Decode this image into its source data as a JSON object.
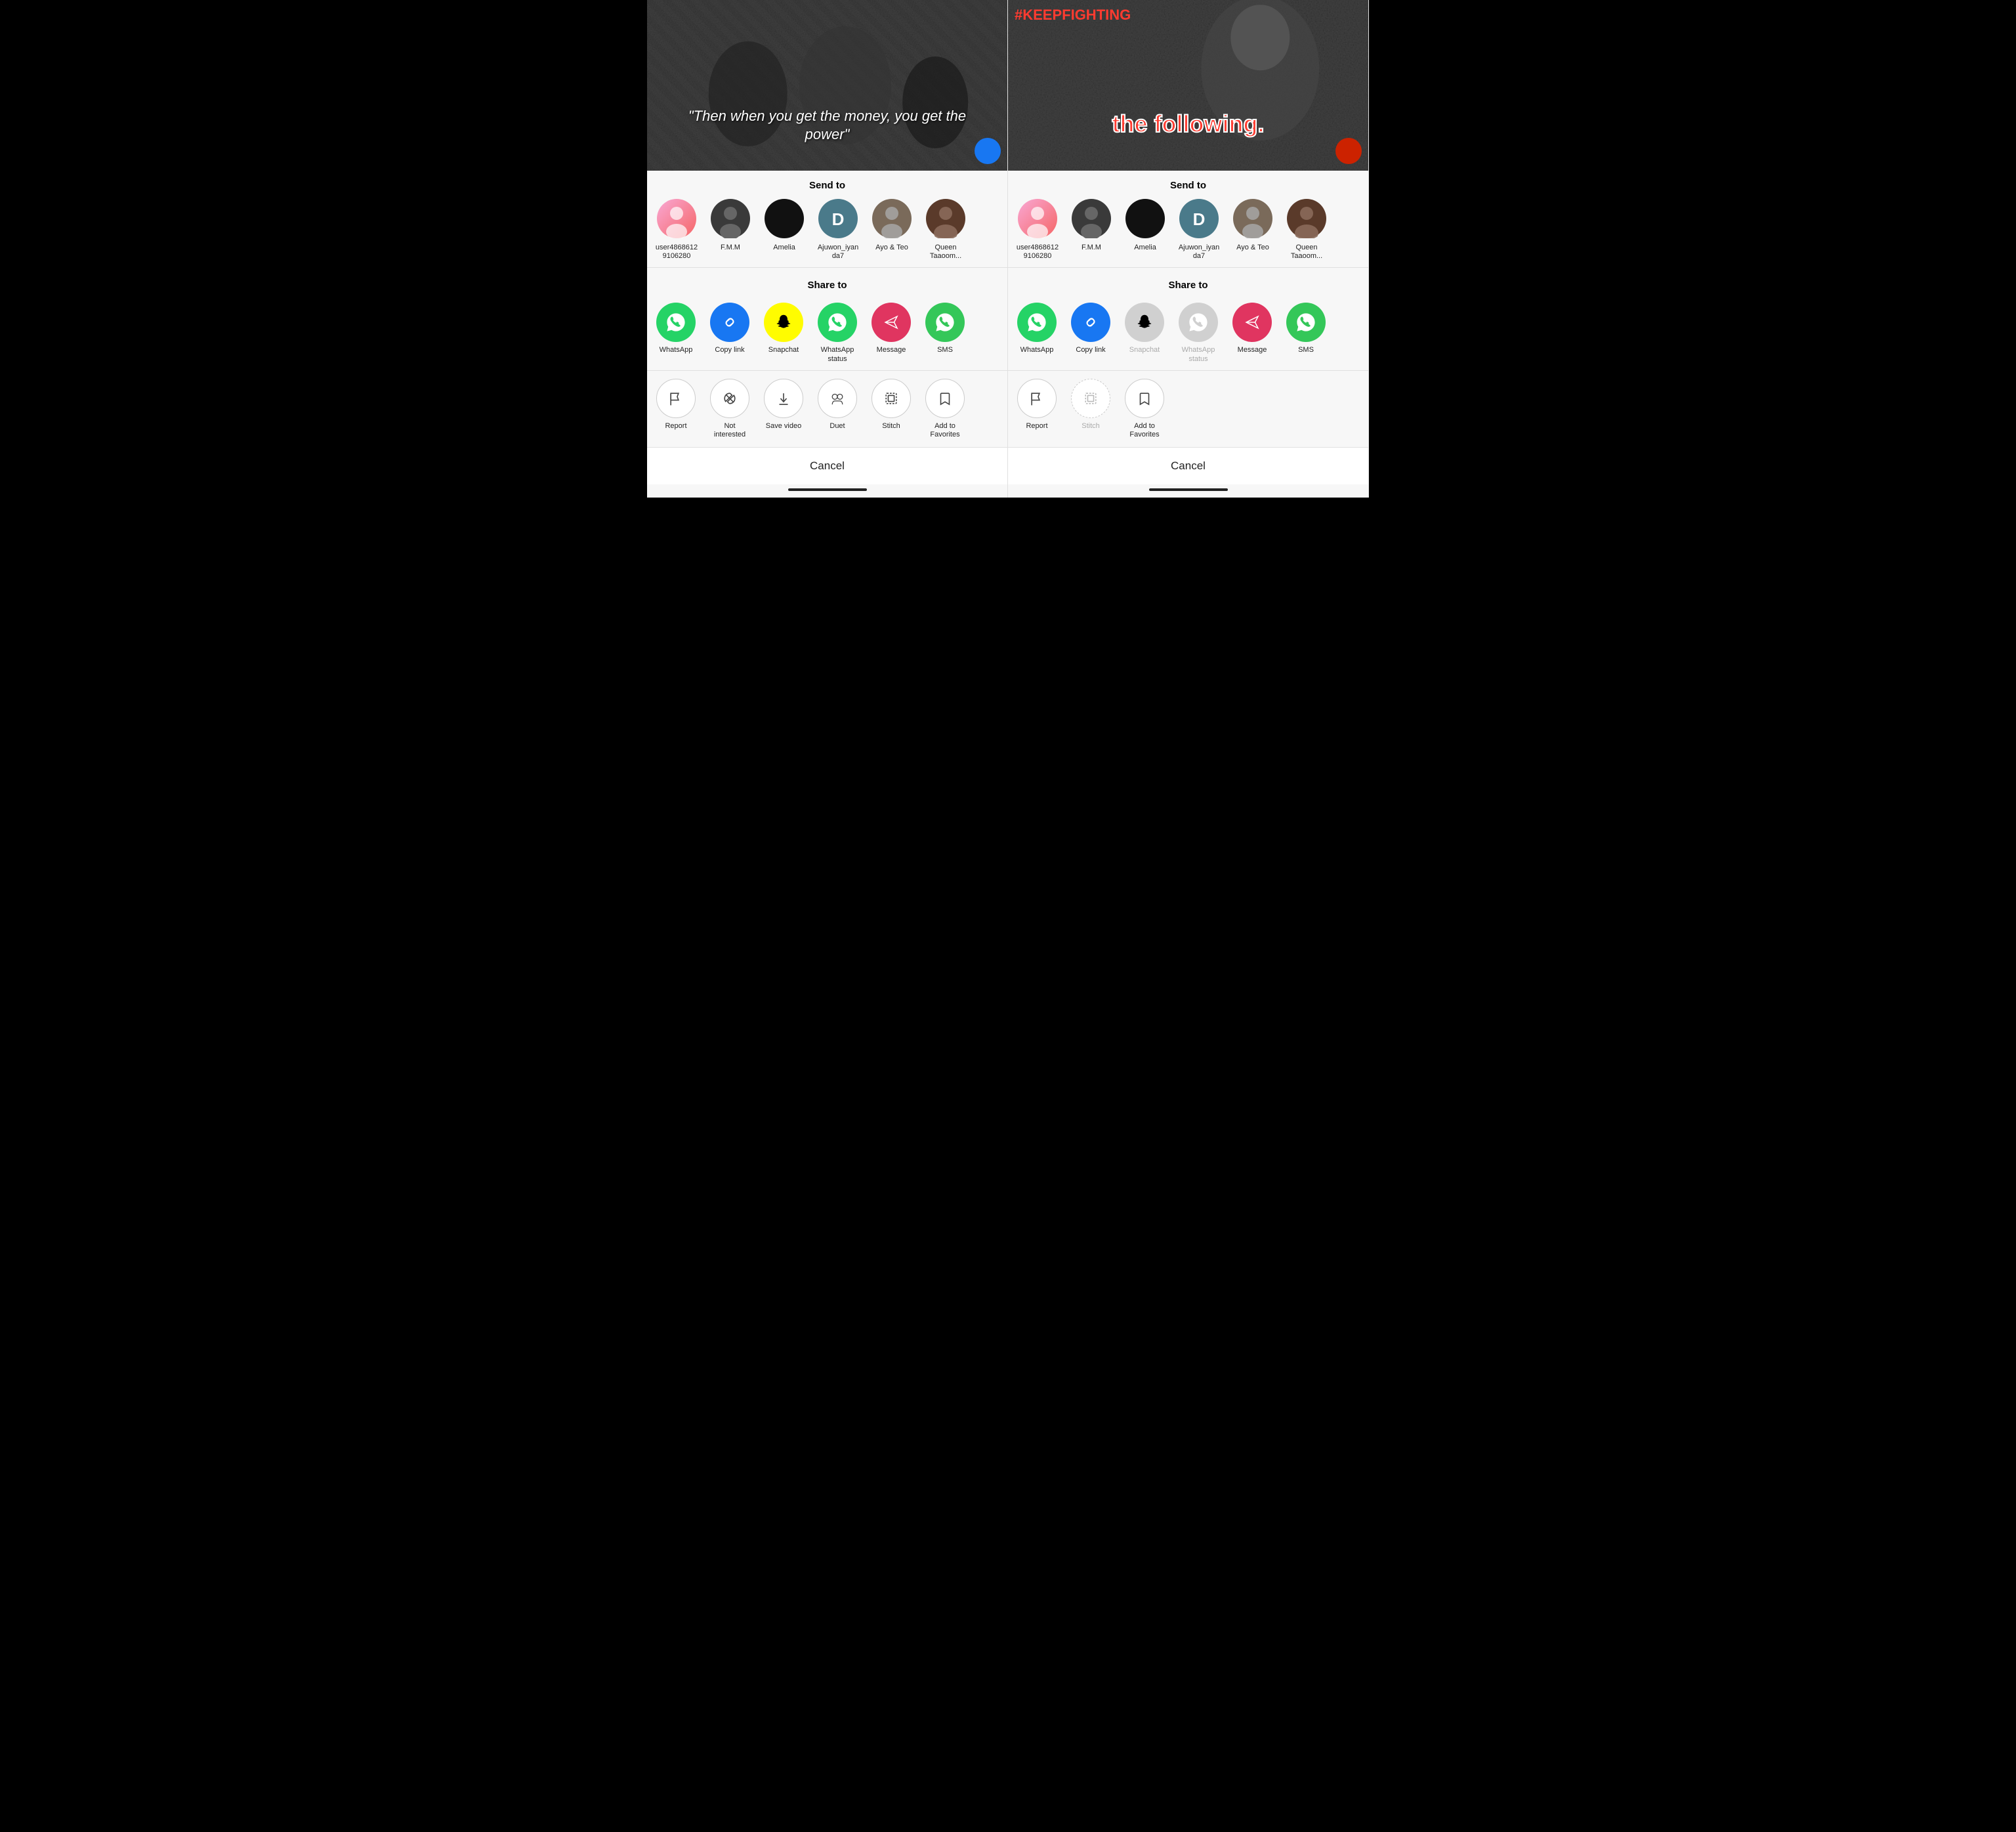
{
  "left_panel": {
    "video": {
      "quote": "\"Then when you get the money, you get the power\"",
      "avatar_color": "#1877f2"
    },
    "send_to_title": "Send to",
    "contacts": [
      {
        "id": "user4868612",
        "name": "user4868612\n9106280",
        "avatar_type": "pink",
        "initials": ""
      },
      {
        "id": "fmm",
        "name": "F.M.M",
        "avatar_type": "dark",
        "initials": ""
      },
      {
        "id": "amelia",
        "name": "Amelia",
        "avatar_type": "black",
        "initials": ""
      },
      {
        "id": "ajuwon",
        "name": "Ajuwon_iyan da7",
        "avatar_type": "teal",
        "initials": "D"
      },
      {
        "id": "ayo",
        "name": "Ayo & Teo",
        "avatar_type": "photo",
        "initials": ""
      },
      {
        "id": "queen",
        "name": "Queen Taaoom...",
        "avatar_type": "woman",
        "initials": ""
      }
    ],
    "share_to_title": "Share to",
    "share_items": [
      {
        "id": "whatsapp",
        "label": "WhatsApp",
        "icon": "💬",
        "bg": "green-bg",
        "disabled": false
      },
      {
        "id": "copy-link",
        "label": "Copy link",
        "icon": "🔗",
        "bg": "blue-bg",
        "disabled": false
      },
      {
        "id": "snapchat",
        "label": "Snapchat",
        "icon": "👻",
        "bg": "yellow-bg",
        "disabled": false
      },
      {
        "id": "whatsapp-status",
        "label": "WhatsApp status",
        "icon": "💬",
        "bg": "green2-bg",
        "disabled": false
      },
      {
        "id": "message",
        "label": "Message",
        "icon": "✈",
        "bg": "red-bg",
        "disabled": false
      },
      {
        "id": "sms",
        "label": "SMS",
        "icon": "💬",
        "bg": "green3-bg",
        "disabled": false
      }
    ],
    "action_items": [
      {
        "id": "report",
        "label": "Report",
        "icon": "⚑",
        "disabled": false
      },
      {
        "id": "not-interested",
        "label": "Not interested",
        "icon": "🤍",
        "disabled": false
      },
      {
        "id": "save-video",
        "label": "Save video",
        "icon": "⬇",
        "disabled": false
      },
      {
        "id": "duet",
        "label": "Duet",
        "icon": "⊙",
        "disabled": false
      },
      {
        "id": "stitch",
        "label": "Stitch",
        "icon": "⊟",
        "disabled": false
      },
      {
        "id": "add-to-favorites",
        "label": "Add to Favorites",
        "icon": "🔖",
        "disabled": false
      }
    ],
    "cancel_label": "Cancel"
  },
  "right_panel": {
    "video": {
      "hashtag": "#KEEPFIGHTING",
      "text": "the following.",
      "avatar_color": "#cc2200"
    },
    "send_to_title": "Send to",
    "contacts": [
      {
        "id": "user4868612",
        "name": "user4868612\n9106280",
        "avatar_type": "pink",
        "initials": ""
      },
      {
        "id": "fmm",
        "name": "F.M.M",
        "avatar_type": "dark",
        "initials": ""
      },
      {
        "id": "amelia",
        "name": "Amelia",
        "avatar_type": "black",
        "initials": ""
      },
      {
        "id": "ajuwon",
        "name": "Ajuwon_iyan da7",
        "avatar_type": "teal",
        "initials": "D"
      },
      {
        "id": "ayo",
        "name": "Ayo & Teo",
        "avatar_type": "photo",
        "initials": ""
      },
      {
        "id": "queen",
        "name": "Queen Taaoom...",
        "avatar_type": "woman",
        "initials": ""
      }
    ],
    "share_to_title": "Share to",
    "share_items": [
      {
        "id": "whatsapp",
        "label": "WhatsApp",
        "icon": "💬",
        "bg": "green-bg",
        "disabled": false
      },
      {
        "id": "copy-link",
        "label": "Copy link",
        "icon": "🔗",
        "bg": "blue-bg",
        "disabled": false
      },
      {
        "id": "snapchat",
        "label": "Snapchat",
        "icon": "👻",
        "bg": "gray-light-bg",
        "disabled": true
      },
      {
        "id": "whatsapp-status",
        "label": "WhatsApp status",
        "icon": "💬",
        "bg": "gray-light-bg",
        "disabled": true
      },
      {
        "id": "message",
        "label": "Message",
        "icon": "✈",
        "bg": "red-bg",
        "disabled": false
      },
      {
        "id": "sms",
        "label": "SMS",
        "icon": "💬",
        "bg": "green3-bg",
        "disabled": false
      }
    ],
    "action_items": [
      {
        "id": "report",
        "label": "Report",
        "icon": "⚑",
        "disabled": false
      },
      {
        "id": "stitch",
        "label": "Stitch",
        "icon": "⊟",
        "disabled": true
      },
      {
        "id": "add-to-favorites",
        "label": "Add to Favorites",
        "icon": "🔖",
        "disabled": false
      }
    ],
    "cancel_label": "Cancel"
  }
}
